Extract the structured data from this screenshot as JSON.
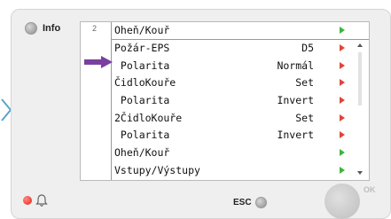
{
  "info_label": "Info",
  "screen": {
    "index": "2",
    "header": {
      "label": "Oheň/Kouř",
      "arrow": "green"
    },
    "rows": [
      {
        "label": "Požár-EPS",
        "value": "D5",
        "arrow": "red"
      },
      {
        "label": " Polarita",
        "value": "Normál",
        "arrow": "red"
      },
      {
        "label": "ČidloKouře",
        "value": "Set",
        "arrow": "red"
      },
      {
        "label": " Polarita",
        "value": "Invert",
        "arrow": "red"
      },
      {
        "label": "2ČidloKouře",
        "value": "Set",
        "arrow": "red"
      },
      {
        "label": " Polarita",
        "value": "Invert",
        "arrow": "red"
      },
      {
        "label": "Oheň/Kouř",
        "value": "",
        "arrow": "green"
      },
      {
        "label": "Vstupy/Výstupy",
        "value": "",
        "arrow": "green"
      }
    ]
  },
  "esc_label": "ESC",
  "ok_label": "OK",
  "colors": {
    "arrow_red": "#e0443a",
    "arrow_green": "#3bb53b",
    "cursor_purple": "#7b3fa0",
    "alarm_led": "#e0201a",
    "side_arrow": "#5aa6c8"
  }
}
